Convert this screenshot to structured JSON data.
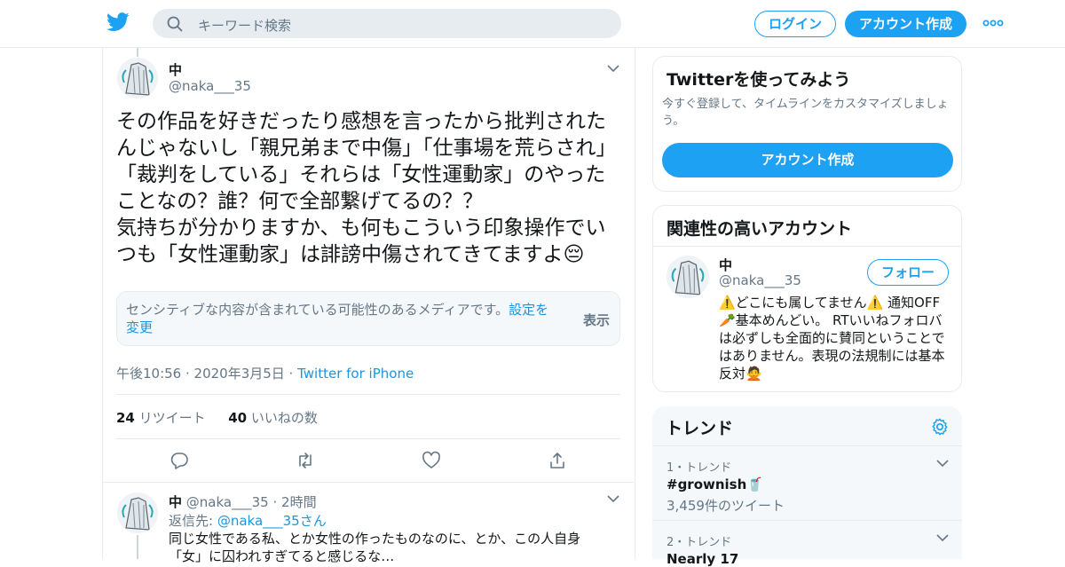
{
  "header": {
    "search_placeholder": "キーワード検索",
    "login_label": "ログイン",
    "signup_label": "アカウント作成"
  },
  "tweet": {
    "name": "中",
    "handle": "@naka___35",
    "text": "その作品を好きだったり感想を言ったから批判されたんじゃないし「親兄弟まで中傷」「仕事場を荒らされ」「裁判をしている」それらは「女性運動家」のやったことなの？誰？何で全部繋げてるの？？\n気持ちが分かりますか、も何もこういう印象操作でいつも「女性運動家」は誹謗中傷されてきてますよ",
    "emoji": "😔",
    "sensitive_text": "センシティブな内容が含まれている可能性のあるメディアです。",
    "sensitive_link": "設定を変更",
    "sensitive_show": "表示",
    "time": "午後10:56 · 2020年3月5日 · ",
    "source": "Twitter for iPhone",
    "retweets_count": "24",
    "retweets_label": " リツイート",
    "likes_count": "40",
    "likes_label": " いいねの数"
  },
  "reply": {
    "name": "中",
    "handle": "@naka___35",
    "time": "2時間",
    "reply_to_prefix": "返信先: ",
    "reply_to_handle": "@naka___35",
    "reply_to_suffix": "さん",
    "text": "同じ女性である私、とか女性の作ったものなのに、とか、この人自身「女」に囚われすぎてると感じるな…"
  },
  "sidebar": {
    "try": {
      "title": "Twitterを使ってみよう",
      "desc": "今すぐ登録して、タイムラインをカスタマイズしましょう。",
      "button": "アカウント作成"
    },
    "related": {
      "title": "関連性の高いアカウント",
      "name": "中",
      "handle": "@naka___35",
      "follow": "フォロー",
      "bio": "⚠️どこにも属してません⚠️ 通知OFF🥕基本めんどい。 RTいいねフォロバは必ずしも全面的に賛同ということではありません。表現の法規制には基本反対🙅"
    },
    "trends": {
      "title": "トレンド",
      "items": [
        {
          "meta": "1・トレンド",
          "name": "#grownish🥤",
          "count": "3,459件のツイート"
        },
        {
          "meta": "2・トレンド",
          "name": "Nearly 17",
          "count": ""
        }
      ]
    }
  },
  "colors": {
    "accent": "#1da1f2",
    "link": "#1b95e0",
    "muted": "#657786"
  }
}
